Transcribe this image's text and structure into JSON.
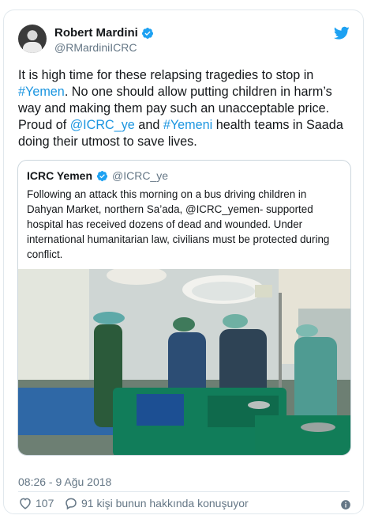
{
  "author": {
    "name": "Robert Mardini",
    "handle": "@RMardiniICRC"
  },
  "tweet": {
    "text_1": "It is high time for these relapsing tragedies to stop in ",
    "hashtag_1": "#Yemen",
    "text_2": ". No one should allow putting children in harm’s way and making them pay such an unacceptable price. Proud of ",
    "mention_1": "@ICRC_ye",
    "text_3": " and ",
    "hashtag_2": "#Yemeni",
    "text_4": " health teams in Saada doing their utmost to save lives."
  },
  "quoted": {
    "name": "ICRC Yemen",
    "handle": "@ICRC_ye",
    "text": "Following an attack this morning on a bus driving children in Dahyan Market, northern Sa’ada, @ICRC_yemen- supported hospital has received dozens of dead and wounded. Under international humanitarian law, civilians must be protected during conflict."
  },
  "meta": {
    "timestamp": "08:26 - 9 Ağu 2018",
    "likes": "107",
    "replies": "91 kişi bunun hakkında konuşuyor"
  },
  "icons": {
    "verified": "verified-badge-icon",
    "bird": "twitter-bird-icon",
    "heart": "heart-icon",
    "reply": "speech-bubble-icon",
    "info": "info-icon"
  },
  "colors": {
    "link": "#1b95e0",
    "twitter_blue": "#1da1f2",
    "secondary_text": "#657786"
  }
}
